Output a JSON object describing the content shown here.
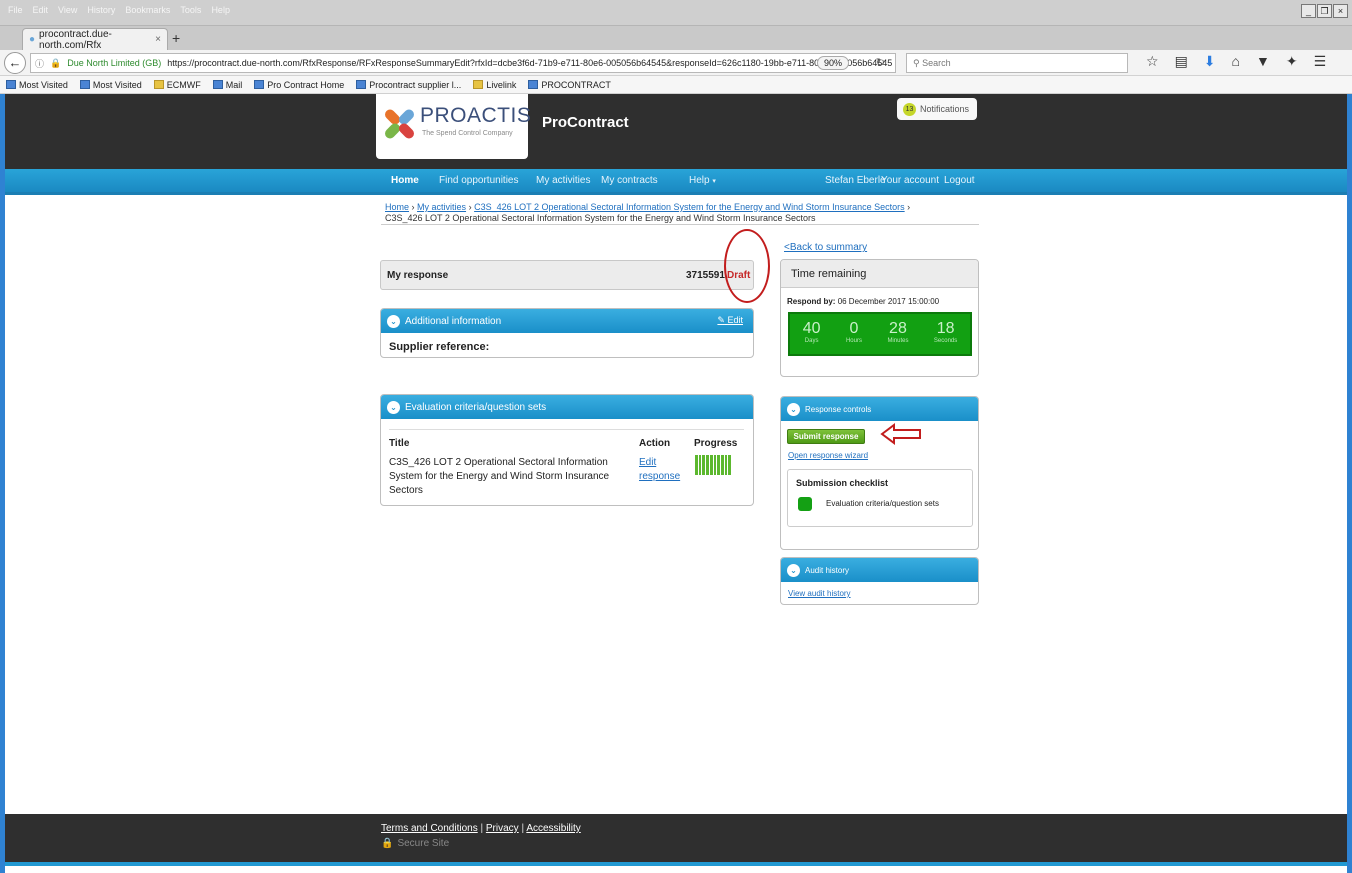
{
  "browser": {
    "menu": [
      "File",
      "Edit",
      "View",
      "History",
      "Bookmarks",
      "Tools",
      "Help"
    ],
    "window_controls": [
      "_",
      "❐",
      "×"
    ],
    "tab_title": "procontract.due-north.com/Rfx",
    "url_identity": "Due North Limited (GB)",
    "url": "https://procontract.due-north.com/RfxResponse/RFxResponseSummaryEdit?rfxId=dcbe3f6d-71b9-e711-80e6-005056b64545&responseId=626c1180-19bb-e711-80e6-005056b64545",
    "zoom": "90%",
    "search_placeholder": "Search",
    "bookmarks": [
      "Most Visited",
      "Most Visited",
      "ECMWF",
      "Mail",
      "Pro Contract Home",
      "Procontract supplier l...",
      "Livelink",
      "PROCONTRACT"
    ]
  },
  "header": {
    "logo_name": "PROACTIS",
    "logo_tagline": "The Spend Control Company",
    "brand": "ProContract",
    "notifications_count": "13",
    "notifications_label": "Notifications"
  },
  "nav": {
    "home": "Home",
    "find": "Find opportunities",
    "activities": "My activities",
    "contracts": "My contracts",
    "help": "Help",
    "user": "Stefan Eberle",
    "account": "Your account",
    "logout": "Logout"
  },
  "breadcrumb": {
    "home": "Home",
    "activities": "My activities",
    "project": "C3S_426 LOT 2 Operational Sectoral Information System for the Energy and Wind Storm Insurance Sectors",
    "sep": "›",
    "current": "C3S_426 LOT 2 Operational Sectoral Information System for the Energy and Wind Storm Insurance Sectors"
  },
  "back_link": "<Back to summary",
  "my_response": {
    "label": "My response",
    "number": "3715591",
    "status": "Draft"
  },
  "additional_info": {
    "title": "Additional information",
    "edit": "Edit",
    "field_label": "Supplier reference:"
  },
  "evaluation": {
    "title": "Evaluation criteria/question sets",
    "headers": {
      "title": "Title",
      "action": "Action",
      "progress": "Progress"
    },
    "row": {
      "title": "C3S_426 LOT 2 Operational Sectoral Information System for the Energy and Wind Storm Insurance Sectors",
      "action": "Edit response",
      "progress_fraction": 1.0
    }
  },
  "time": {
    "title": "Time remaining",
    "respond_by_label": "Respond by:",
    "respond_by_value": "06 December 2017 15:00:00",
    "days": "40",
    "days_label": "Days",
    "hours": "0",
    "hours_label": "Hours",
    "minutes": "28",
    "minutes_label": "Minutes",
    "seconds": "18",
    "seconds_label": "Seconds"
  },
  "controls": {
    "title": "Response controls",
    "submit": "Submit response",
    "wizard": "Open response wizard",
    "checklist_title": "Submission checklist",
    "checklist_item": "Evaluation criteria/question sets"
  },
  "audit": {
    "title": "Audit history",
    "link": "View audit history"
  },
  "footer": {
    "terms": "Terms and Conditions",
    "privacy": "Privacy",
    "accessibility": "Accessibility",
    "sep": "|",
    "secure": "Secure Site"
  },
  "colors": {
    "nav_blue": "#1a89c2",
    "header_dark": "#2f2f2f",
    "draft_red": "#c62828",
    "timer_green": "#12a012"
  }
}
